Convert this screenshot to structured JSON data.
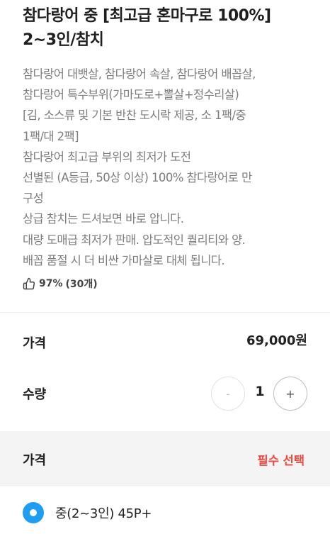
{
  "product": {
    "title_lines": [
      "참다랑어 중 [최고급 혼마구로 100%]",
      "2~3인/참치"
    ],
    "description_lines": [
      "참다랑어 대뱃살, 참다랑어 속살, 참다랑어 배꼽살,",
      "참다랑어 특수부위(가마도로+뽈살+정수리살)",
      "[김, 소스류 및 기본 반찬 도시락 제공, 소 1팩/중",
      "1팩/대 2팩]",
      "참다랑어 최고급 부위의 최저가 도전",
      "선별된 (A등급, 50상 이상) 100% 참다랑어로 만",
      "구성",
      "상급 참치는 드셔보면 바로 압니다.",
      "대량 도매급 최저가 판매. 압도적인 퀄리티와 양.",
      "배꼽 품절 시 더 비싼 가마살로 대체 됩니다."
    ],
    "rating": {
      "icon": "thumbs-up-icon",
      "percent": "97%",
      "count": "(30개)"
    }
  },
  "price": {
    "label": "가격",
    "value": "69,000원"
  },
  "quantity": {
    "label": "수량",
    "value": "1",
    "minus_label": "-",
    "plus_label": "+"
  },
  "option": {
    "header_label": "가격",
    "required_label": "필수 선택",
    "required_color": "#f0463c",
    "selected_text": "중(2~3인) 45P+",
    "radio_color": "#1e9df2"
  }
}
